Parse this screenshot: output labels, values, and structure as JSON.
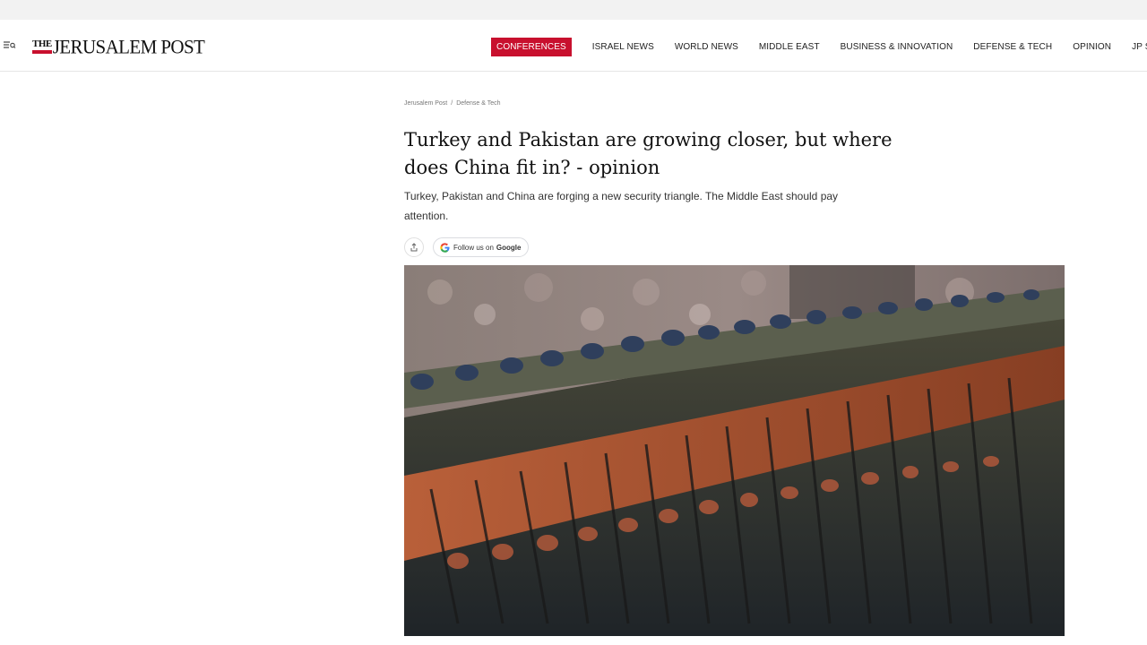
{
  "header": {
    "logo_the": "THE",
    "logo_name": "JERUSALEM POST",
    "nav": [
      "CONFERENCES",
      "ISRAEL NEWS",
      "WORLD NEWS",
      "MIDDLE EAST",
      "BUSINESS & INNOVATION",
      "DEFENSE & TECH",
      "OPINION",
      "JP STORE"
    ],
    "highlight_color": "#c8102e"
  },
  "article": {
    "breadcrumb": [
      "Jerusalem Post",
      "Defense & Tech"
    ],
    "breadcrumb_separator": "/",
    "headline": "Turkey and Pakistan are growing closer, but where does China fit in? - opinion",
    "subtitle": "Turkey, Pakistan and China are forging a new security triangle. The Middle East should pay attention.",
    "follow_prefix": "Follow us on",
    "follow_brand": "Google",
    "share_icon": "share-icon",
    "hero_image": "soldiers-parade-photo"
  }
}
